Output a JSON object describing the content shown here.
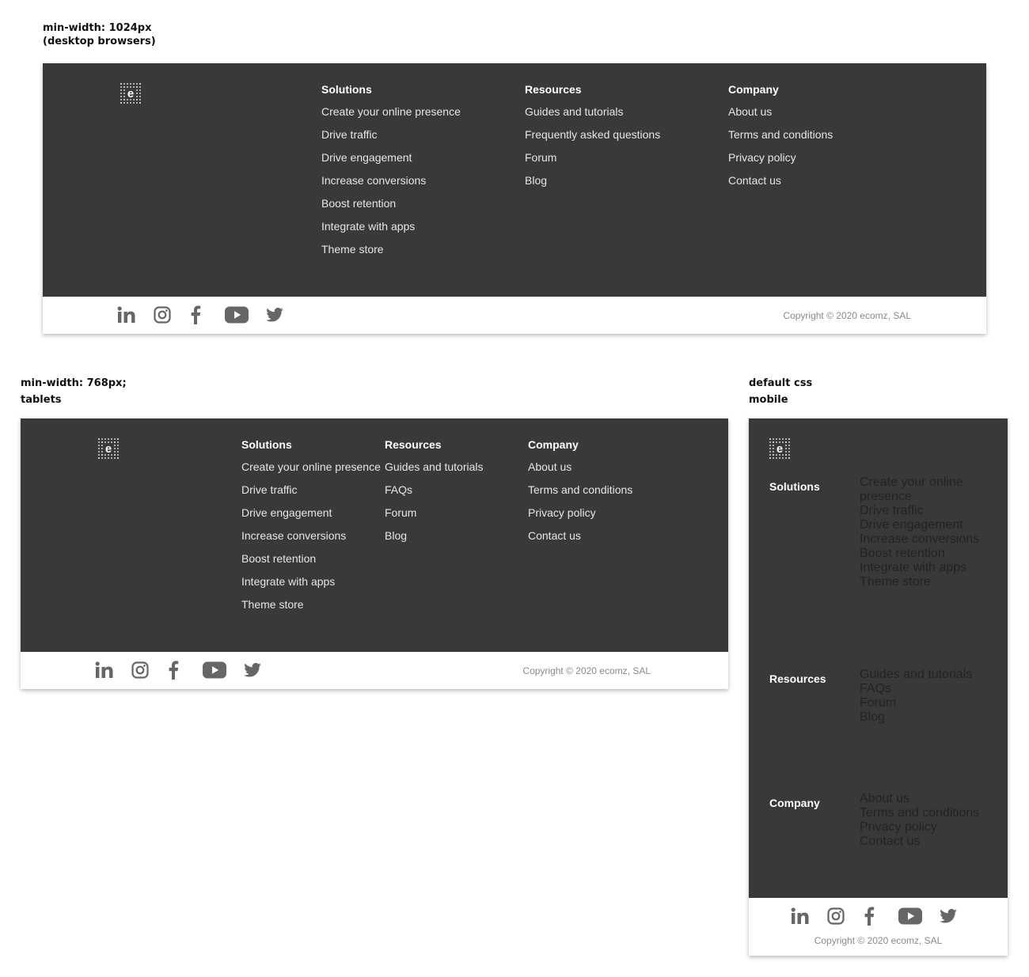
{
  "captions": {
    "desktop": [
      "min-width: 1024px",
      "(desktop browsers)"
    ],
    "tablet": [
      "min-width: 768px;",
      "tablets"
    ],
    "mobile": [
      "default css",
      "mobile"
    ]
  },
  "logo": {
    "letter": "e",
    "icon": "ecomz-logo-icon"
  },
  "columns": [
    {
      "title": "Solutions",
      "items": [
        "Create your online presence",
        "Drive traffic",
        "Drive engagement",
        "Increase conversions",
        "Boost retention",
        "Integrate with apps",
        "Theme store"
      ]
    },
    {
      "title": "Resources",
      "items": [
        "Guides and tutorials",
        "Frequently asked questions",
        "Forum",
        "Blog"
      ]
    },
    {
      "title": "Company",
      "items": [
        "About us",
        "Terms and conditions",
        "Privacy policy",
        "Contact us"
      ]
    }
  ],
  "tablet_columns": [
    {
      "title": "Solutions",
      "items": [
        "Create your online presence",
        "Drive traffic",
        "Drive engagement",
        "Increase conversions",
        "Boost retention",
        "Integrate with apps",
        "Theme store"
      ]
    },
    {
      "title": "Resources",
      "items": [
        "Guides and tutorials",
        "FAQs",
        "Forum",
        "Blog"
      ]
    },
    {
      "title": "Company",
      "items": [
        "About us",
        "Terms and conditions",
        "Privacy policy",
        "Contact us"
      ]
    }
  ],
  "social": [
    "linkedin-icon",
    "instagram-icon",
    "facebook-icon",
    "youtube-icon",
    "twitter-icon"
  ],
  "copyright": "Copyright © 2020 ecomz, SAL",
  "colors": {
    "footer_bg": "#393939",
    "link_text": "#e6e6e6",
    "icon_gray": "#666666",
    "copyright": "#8a8a8a"
  }
}
